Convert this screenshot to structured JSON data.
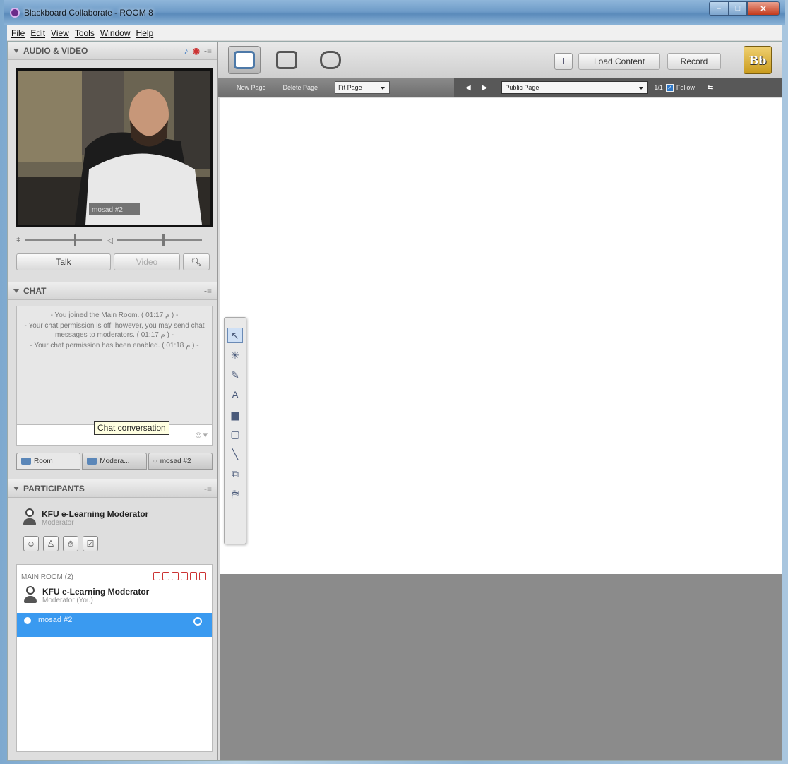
{
  "window": {
    "title": "Blackboard Collaborate - ROOM 8"
  },
  "menu": [
    "File",
    "Edit",
    "View",
    "Tools",
    "Window",
    "Help"
  ],
  "audio_video": {
    "header": "AUDIO & VIDEO",
    "video_caption": "mosad #2",
    "talk_label": "Talk",
    "video_label": "Video"
  },
  "chat": {
    "header": "CHAT",
    "messages": [
      "- You joined the Main Room. ( 01:17 م ) -",
      "- Your chat permission is off; however, you may send chat messages to moderators. ( 01:17 م ) -",
      "- Your chat permission has been enabled. ( 01:18 م ) -"
    ],
    "tooltip": "Chat conversation",
    "tabs": [
      "Room",
      "Modera...",
      "mosad #2"
    ]
  },
  "participants": {
    "header": "PARTICIPANTS",
    "me_name": "KFU e-Learning Moderator",
    "me_role": "Moderator",
    "room_label": "MAIN ROOM (2)",
    "list": [
      {
        "name": "KFU e-Learning Moderator",
        "role": "Moderator (You)"
      },
      {
        "name": "mosad #2"
      }
    ]
  },
  "toolbar": {
    "info_label": "i",
    "load_content": "Load Content",
    "record": "Record",
    "logo": "Bb"
  },
  "page_toolbar": {
    "new_page": "New Page",
    "delete_page": "Delete Page",
    "fit_page": "Fit Page",
    "page_select": "Public Page",
    "page_count": "1/1",
    "follow": "Follow"
  },
  "colors": {
    "selected_row": "#3a9af0",
    "accent": "#4d79a8"
  }
}
